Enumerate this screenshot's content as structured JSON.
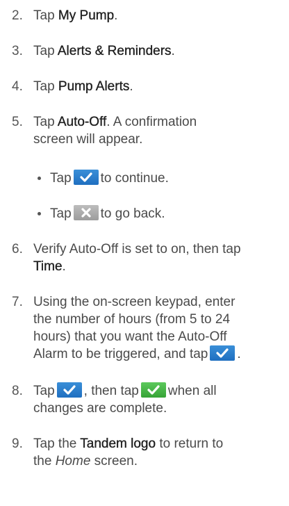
{
  "steps": [
    {
      "num": "2.",
      "pre": "Tap ",
      "bold": "My Pump",
      "post": "."
    },
    {
      "num": "3.",
      "pre": "Tap ",
      "bold": "Alerts & Reminders",
      "post": "."
    },
    {
      "num": "4.",
      "pre": "Tap ",
      "bold": "Pump Alerts",
      "post": "."
    },
    {
      "num": "5.",
      "pre": "Tap ",
      "bold": "Auto-Off",
      "post": ". A confirmation",
      "line2": "screen will appear."
    },
    {
      "num": "6.",
      "line1": "Verify Auto-Off is set to on, then tap",
      "bold2": "Time",
      "post2": "."
    },
    {
      "num": "7.",
      "line1": "Using the on-screen keypad, enter",
      "line2": "the number of hours (from 5 to 24",
      "line3": "hours) that you want the Auto-Off",
      "line4": "Alarm to be triggered, and tap",
      "post4": "."
    },
    {
      "num": "8.",
      "pre": "Tap",
      "mid": ", then tap",
      "post": "when all",
      "line2": "changes are complete."
    },
    {
      "num": "9.",
      "pre": "Tap the ",
      "bold": "Tandem logo",
      "post": " to return to",
      "line2pre": "the ",
      "line2ital": "Home",
      "line2post": " screen."
    }
  ],
  "bullets": [
    {
      "pre": "Tap",
      "post": "to continue.",
      "icon": "checkmark-button-icon"
    },
    {
      "pre": "Tap",
      "post": "to go back.",
      "icon": "x-button-icon"
    }
  ],
  "colors": {
    "check_button": "#2b7fce",
    "confirm_button": "#47b647",
    "x_button": "#a8a8a8"
  }
}
